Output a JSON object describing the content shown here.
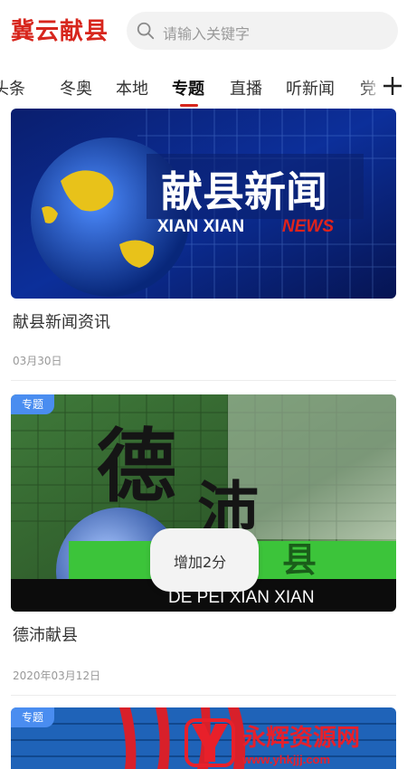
{
  "header": {
    "app_title": "冀云献县",
    "search_placeholder": "请输入关键字",
    "search_icon": "search-icon"
  },
  "tabs": [
    {
      "label": "头条"
    },
    {
      "label": "冬奥"
    },
    {
      "label": "本地"
    },
    {
      "label": "专题"
    },
    {
      "label": "直播"
    },
    {
      "label": "听新闻"
    },
    {
      "label": "党"
    }
  ],
  "active_tab": "专题",
  "add_icon": "plus-icon",
  "colors": {
    "brand": "#d7261d",
    "badge": "#4a8df0"
  },
  "cards": [
    {
      "image_text_cn": "献县新闻",
      "image_text_en": "XIAN XIAN",
      "image_text_news": "NEWS",
      "title": "献县新闻资讯",
      "date": "03月30日"
    },
    {
      "badge": "专题",
      "image_text_1": "德",
      "image_text_2": "沛",
      "image_text_3": "县",
      "image_text_en": "DE PEI XIAN XIAN",
      "title": "德沛献县",
      "date": "2020年03月12日"
    },
    {
      "badge": "专题",
      "watermark_cn": "永辉资源网",
      "watermark_url": "www.yhkjjj.com"
    }
  ],
  "toast": {
    "text": "增加2分"
  }
}
